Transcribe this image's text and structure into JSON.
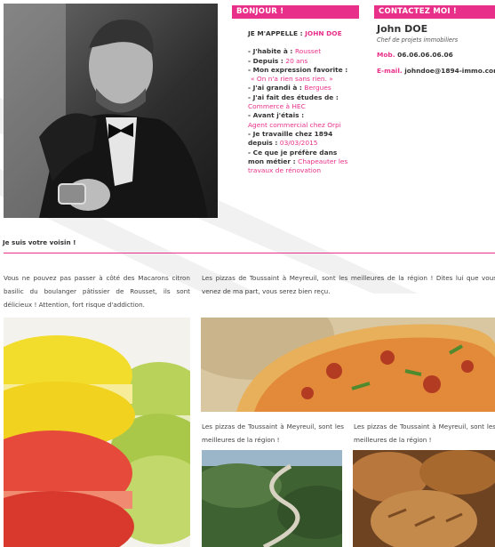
{
  "bonjour": {
    "title": "BONJOUR !"
  },
  "bio": {
    "intro_label": "JE M'APPELLE : ",
    "intro_name": "JOHN DOE",
    "lives_label": "- J'habite à : ",
    "lives_value": "Rousset",
    "age_label": "- Depuis : ",
    "age_value": "20 ans",
    "expr_label": "- Mon expression favorite :",
    "expr_value": "« On n'a rien sans rien. »",
    "grew_label": "- J'ai grandi à : ",
    "grew_value": "Bergues",
    "studies_label": "- J'ai fait des études de :",
    "studies_value": "Commerce à HEC",
    "before_label": "- Avant j'étais :",
    "before_value": "Agent commercial chez Orpi",
    "since_label": "- Je travaille chez 1894 depuis : ",
    "since_value": "03/03/2015",
    "prefer_label": "- Ce que je préfère dans mon métier : ",
    "prefer_value": "Chapeauter les travaux de rénovation"
  },
  "contact": {
    "title": "CONTACTEZ MOI !",
    "name": "John DOE",
    "role": "Chef de projets immobiliers",
    "mob_label": "Mob. ",
    "mob_value": "06.06.06.06.06",
    "email_label": "E-mail. ",
    "email_value": "johndoe@1894-immo.com"
  },
  "neighbor": {
    "heading": "Je suis votre voisin !"
  },
  "articles": {
    "macarons_text": "Vous ne pouvez pas passer à côté des Macarons citron basilic du boulanger pâtissier de Rousset, ils sont délicieux ! Attention, fort risque d'addiction.",
    "pizza_text": "Les pizzas de Toussaint à Meyreuil, sont les meilleures de la région ! Dites lui que vous venez de ma part, vous serez bien reçu.",
    "caption_left": "Les pizzas de Toussaint à Meyreuil, sont les meilleures de la région !",
    "caption_right": "Les pizzas de Toussaint à Meyreuil, sont les meilleures de la région !"
  },
  "colors": {
    "accent": "#e8308a",
    "text": "#333333"
  }
}
